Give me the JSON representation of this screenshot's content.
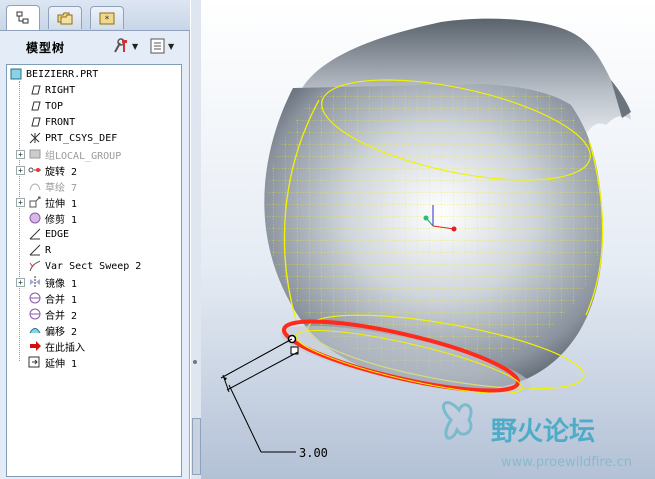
{
  "model_tree": {
    "title": "模型树",
    "items": [
      {
        "label": "BEIZIERR.PRT",
        "icon": "part-icon",
        "expand": false,
        "dim": false,
        "indent": 0
      },
      {
        "label": "RIGHT",
        "icon": "datum-plane-icon",
        "expand": false,
        "dim": false,
        "indent": 1
      },
      {
        "label": "TOP",
        "icon": "datum-plane-icon",
        "expand": false,
        "dim": false,
        "indent": 1
      },
      {
        "label": "FRONT",
        "icon": "datum-plane-icon",
        "expand": false,
        "dim": false,
        "indent": 1
      },
      {
        "label": "PRT_CSYS_DEF",
        "icon": "csys-icon",
        "expand": false,
        "dim": false,
        "indent": 1
      },
      {
        "label": "组LOCAL_GROUP",
        "icon": "group-icon",
        "expand": true,
        "dim": true,
        "indent": 1
      },
      {
        "label": "旋转 2",
        "icon": "revolve-icon",
        "expand": true,
        "dim": false,
        "indent": 1
      },
      {
        "label": "草绘 7",
        "icon": "sketch-icon",
        "expand": false,
        "dim": true,
        "indent": 1
      },
      {
        "label": "拉伸 1",
        "icon": "extrude-icon",
        "expand": true,
        "dim": false,
        "indent": 1
      },
      {
        "label": "修剪 1",
        "icon": "trim-icon",
        "expand": false,
        "dim": false,
        "indent": 1
      },
      {
        "label": "EDGE",
        "icon": "datum-curve-icon",
        "expand": false,
        "dim": false,
        "indent": 1
      },
      {
        "label": "R",
        "icon": "datum-curve-icon",
        "expand": false,
        "dim": false,
        "indent": 1
      },
      {
        "label": "Var Sect Sweep 2",
        "icon": "sweep-icon",
        "expand": false,
        "dim": false,
        "indent": 1
      },
      {
        "label": "镜像 1",
        "icon": "mirror-icon",
        "expand": true,
        "dim": false,
        "indent": 1
      },
      {
        "label": "合并 1",
        "icon": "merge-icon",
        "expand": false,
        "dim": false,
        "indent": 1
      },
      {
        "label": "合并 2",
        "icon": "merge-icon",
        "expand": false,
        "dim": false,
        "indent": 1
      },
      {
        "label": "偏移 2",
        "icon": "offset-icon",
        "expand": false,
        "dim": false,
        "indent": 1
      },
      {
        "label": "在此插入",
        "icon": "insert-here-arrow-icon",
        "expand": false,
        "dim": false,
        "indent": 1
      },
      {
        "label": "延伸 1",
        "icon": "extend-icon",
        "expand": false,
        "dim": false,
        "indent": 1
      }
    ]
  },
  "tabs": [
    {
      "name": "tab-model-tree",
      "icon": "tree-icon"
    },
    {
      "name": "tab-folder-browser",
      "icon": "folder-icon"
    },
    {
      "name": "tab-favorites",
      "icon": "favorites-icon"
    }
  ],
  "viewport": {
    "dimension_value": "3.00"
  },
  "watermark": {
    "name": "野火论坛",
    "url": "www.proewildfire.cn"
  },
  "colors": {
    "highlight_edge": "#ff2a1a",
    "mesh": "#f2f200",
    "surface": "#9aa3ad"
  }
}
